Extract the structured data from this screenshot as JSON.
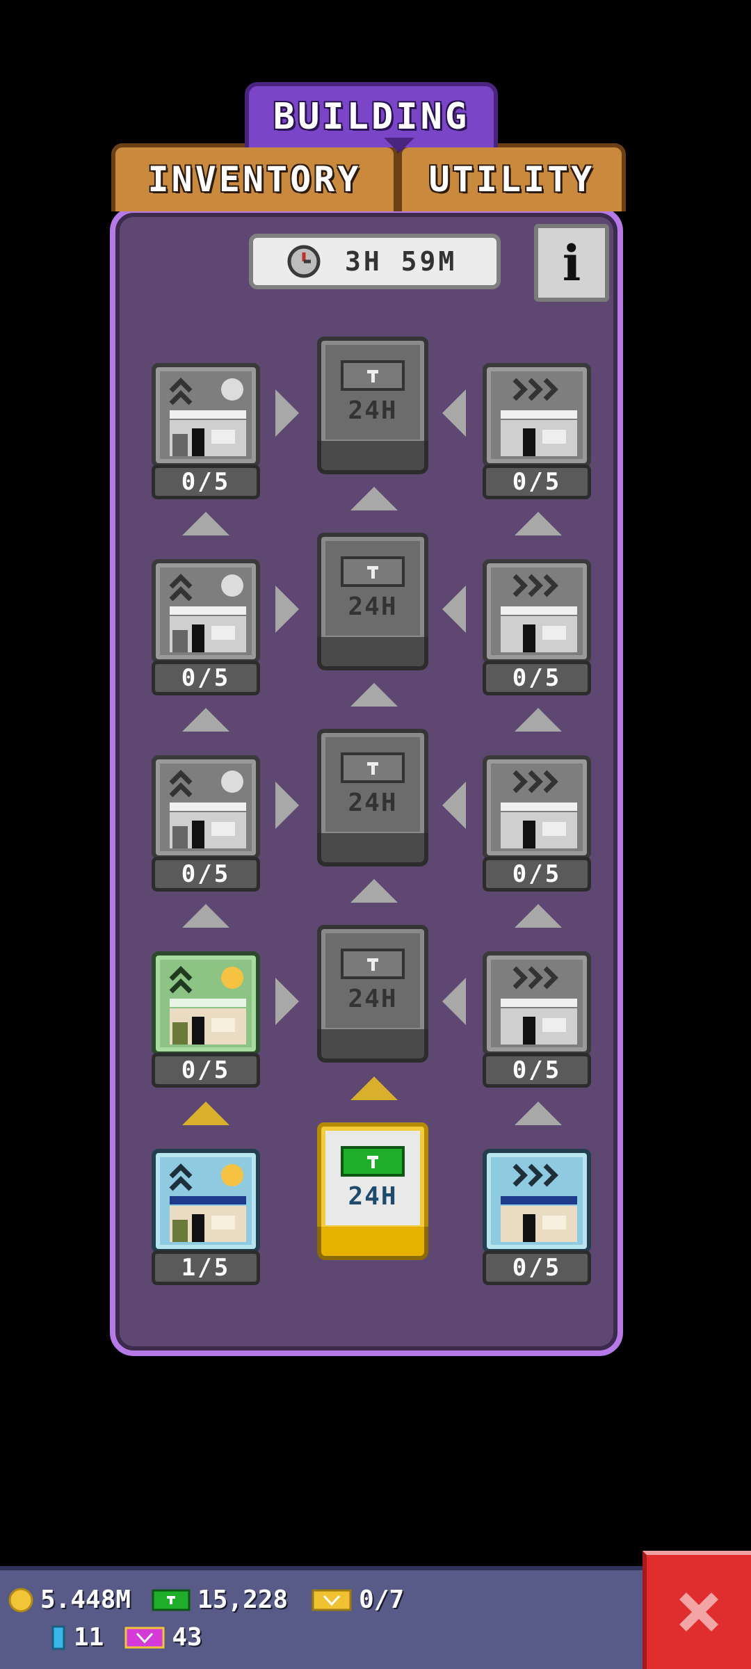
{
  "tabs": {
    "building": "BUILDING",
    "inventory": "INVENTORY",
    "utility": "UTILITY"
  },
  "timer": {
    "text": "3H 59M"
  },
  "info": {
    "label": "i"
  },
  "tree": {
    "rows": [
      {
        "left_count": "0/5",
        "mid_hours": "24H",
        "right_count": "0/5"
      },
      {
        "left_count": "0/5",
        "mid_hours": "24H",
        "right_count": "0/5"
      },
      {
        "left_count": "0/5",
        "mid_hours": "24H",
        "right_count": "0/5"
      },
      {
        "left_count": "0/5",
        "mid_hours": "24H",
        "right_count": "0/5"
      },
      {
        "left_count": "1/5",
        "mid_hours": "24H",
        "right_count": "0/5"
      }
    ]
  },
  "resources": {
    "coins": "5.448M",
    "bux": "15,228",
    "tickets": "0/7",
    "gems": "11",
    "vip": "43"
  },
  "colors": {
    "panel": "#5e4872",
    "panel_border": "#b57ae8",
    "tab_building": "#7b45c8",
    "tab_orange": "#c98a3e",
    "gold": "#e6b100",
    "close_red": "#e02d2d"
  }
}
